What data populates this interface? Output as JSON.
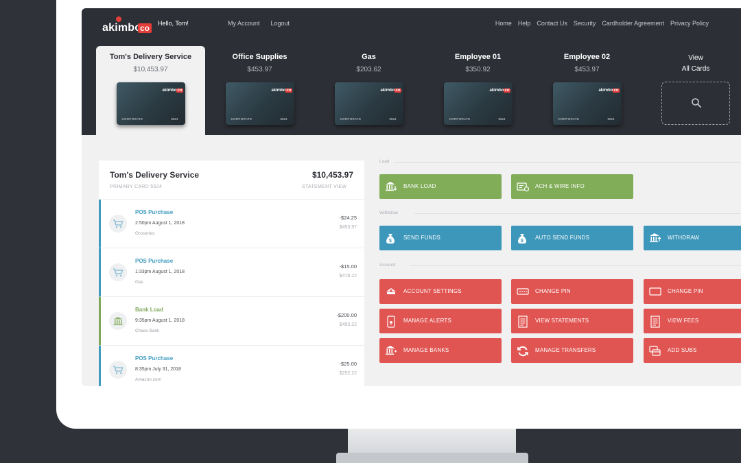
{
  "header": {
    "logo_text": "akimbo",
    "logo_badge": "co",
    "greeting": "Hello, Tom!",
    "nav_left": [
      "My Account",
      "Logout"
    ],
    "nav_right": [
      "Home",
      "Help",
      "Contact Us",
      "Security",
      "Cardholder Agreement",
      "Privacy Policy"
    ]
  },
  "cards": [
    {
      "name": "Tom's Delivery Service",
      "balance": "$10,453.97",
      "type": "CORPORATE",
      "last4": "5524",
      "active": true
    },
    {
      "name": "Office Supplies",
      "balance": "$453.97",
      "type": "CORPORATE",
      "last4": "5524"
    },
    {
      "name": "Gas",
      "balance": "$203.62",
      "type": "CORPORATE",
      "last4": "5524"
    },
    {
      "name": "Employee 01",
      "balance": "$350.92",
      "type": "CORPORATE",
      "last4": "5524"
    },
    {
      "name": "Employee 02",
      "balance": "$453.97",
      "type": "CORPORATE",
      "last4": "5524"
    }
  ],
  "card_logo": {
    "word": "akimbo",
    "badge": "co"
  },
  "view_all": {
    "line1": "View",
    "line2": "All Cards"
  },
  "account_panel": {
    "name": "Tom's Delivery Service",
    "balance": "$10,453.97",
    "subtitle": "PRIMARY CARD 5524",
    "link": "STATEMENT VIEW",
    "transactions": [
      {
        "title": "POS Purchase",
        "date": "2:50pm August 1, 2018",
        "category": "Groceries",
        "amount": "-$24.25",
        "running": "$453.97",
        "icon": "cart-icon"
      },
      {
        "title": "POS Purchase",
        "date": "1:33pm August 1, 2018",
        "category": "Gas",
        "amount": "-$15.00",
        "running": "$478.22",
        "icon": "cart-icon"
      },
      {
        "title": "Bank Load",
        "date": "9:35pm August 1, 2018",
        "category": "Chase Bank",
        "amount": "-$200.00",
        "running": "$493.22",
        "icon": "bank-icon"
      },
      {
        "title": "POS Purchase",
        "date": "8:35pm July 31, 2018",
        "category": "Amazon.com",
        "amount": "-$25.00",
        "running": "$292.22",
        "icon": "cart-icon"
      }
    ]
  },
  "sections": {
    "load": "Load",
    "withdraw": "Withdraw",
    "account": "Account"
  },
  "actions": {
    "load": [
      {
        "label": "BANK LOAD",
        "icon": "bank-load-icon"
      },
      {
        "label": "ACH & WIRE INFO",
        "icon": "wire-info-icon"
      }
    ],
    "withdraw": [
      {
        "label": "SEND FUNDS",
        "icon": "money-bag-icon"
      },
      {
        "label": "AUTO SEND FUNDS",
        "icon": "money-bag-icon"
      },
      {
        "label": "WITHDRAW",
        "icon": "bank-withdraw-icon"
      }
    ],
    "account": [
      {
        "label": "ACCOUNT SETTINGS",
        "icon": "settings-icon"
      },
      {
        "label": "CHANGE PIN",
        "icon": "pin-icon"
      },
      {
        "label": "CHANGE PIN",
        "icon": "card-icon"
      },
      {
        "label": "MANAGE ALERTS",
        "icon": "phone-alert-icon"
      },
      {
        "label": "VIEW STATEMENTS",
        "icon": "document-icon"
      },
      {
        "label": "VIEW FEES",
        "icon": "document-icon"
      },
      {
        "label": "MANAGE BANKS",
        "icon": "bank-icon"
      },
      {
        "label": "MANAGE TRANSFERS",
        "icon": "refresh-icon"
      },
      {
        "label": "ADD SUBS",
        "icon": "cards-icon"
      }
    ]
  },
  "colors": {
    "load": "#81ad59",
    "withdraw": "#3d97ba",
    "account": "#e05552",
    "header": "#2c2f35"
  }
}
